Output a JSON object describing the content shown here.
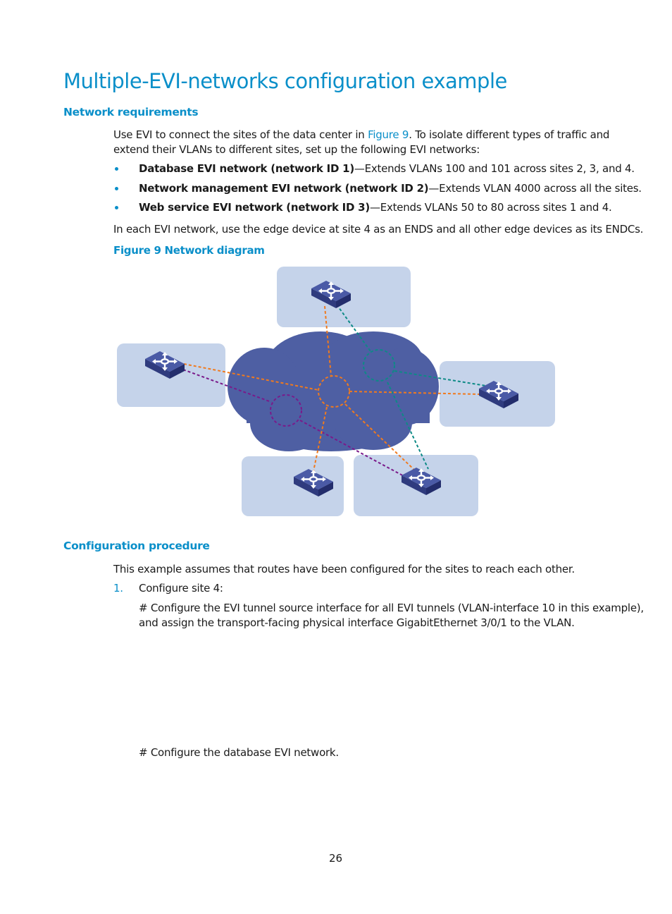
{
  "title": "Multiple-EVI-networks configuration example",
  "section_requirements": {
    "heading": "Network requirements",
    "intro_before_link": "Use EVI to connect the sites of the data center in ",
    "intro_link": "Figure 9",
    "intro_after_link": ". To isolate different types of traffic and extend their VLANs to different sites, set up the following EVI networks:",
    "bullets": [
      {
        "bold": "Database EVI network (network ID 1)",
        "text": "—Extends VLANs 100 and 101 across sites 2, 3, and 4."
      },
      {
        "bold": "Network management EVI network (network ID 2)",
        "text": "—Extends VLAN 4000 across all the sites."
      },
      {
        "bold": "Web service EVI network (network ID 3)",
        "text": "—Extends VLANs 50 to 80 across sites 1 and 4."
      }
    ],
    "closing": "In each EVI network, use the edge device at site 4 as an ENDS and all other edge devices as its ENDCs."
  },
  "figure": {
    "caption": "Figure 9 Network diagram",
    "colors": {
      "site_box": "#c5d3ea",
      "cloud": "#4e5fa3",
      "switch_top": "#4a5aa6",
      "switch_side": "#2f3b7e",
      "network_db_orange": "#f07a1e",
      "network_mgmt_teal": "#0d8a86",
      "network_web_purple": "#7a1a8a"
    },
    "icons": [
      "switch-icon",
      "switch-icon",
      "switch-icon",
      "switch-icon",
      "switch-icon"
    ]
  },
  "section_procedure": {
    "heading": "Configuration procedure",
    "intro": "This example assumes that routes have been configured for the sites to reach each other.",
    "steps": [
      {
        "number": "1.",
        "label": "Configure site 4:"
      }
    ],
    "comment1_line1": "# Configure the EVI tunnel source interface for all EVI tunnels (VLAN-interface 10 in this example),",
    "comment1_line2": "and assign the transport-facing physical interface GigabitEthernet 3/0/1 to the VLAN.",
    "comment2": "# Configure the database EVI network."
  },
  "page_number": "26"
}
